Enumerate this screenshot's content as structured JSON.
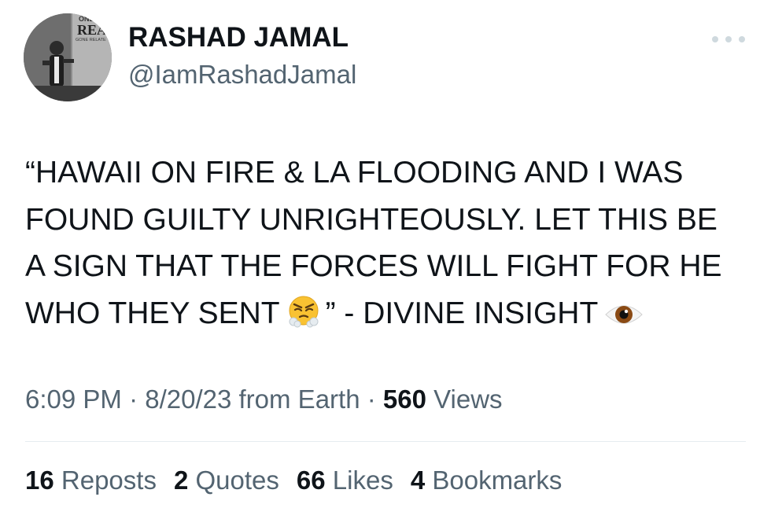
{
  "author": {
    "display_name": "RASHAD JAMAL",
    "handle": "@IamRashadJamal",
    "avatar_overlay_text": [
      "ONLY",
      "REAL",
      "GONE RELATE"
    ]
  },
  "more_menu": {
    "icon": "more-horizontal-icon"
  },
  "tweet": {
    "lines": [
      "“HAWAII ON FIRE & LA FLOODING AND I WAS",
      "FOUND GUILTY UNRIGHTEOUSLY. LET THIS BE",
      "A SIGN THAT THE FORCES WILL FIGHT FOR HE"
    ],
    "last_line_start": "WHO THEY SENT",
    "emoji_1": "face-with-steam-from-nose-emoji",
    "last_line_middle": "” - DIVINE INSIGHT",
    "emoji_2": "eye-emoji"
  },
  "meta": {
    "time": "6:09 PM",
    "sep1": " · ",
    "date": "8/20/23",
    "source": " from Earth",
    "sep2": " · ",
    "views_count": "560",
    "views_label": " Views"
  },
  "stats": [
    {
      "num": "16",
      "label": " Reposts"
    },
    {
      "num": "2",
      "label": " Quotes"
    },
    {
      "num": "66",
      "label": " Likes"
    },
    {
      "num": "4",
      "label": " Bookmarks"
    }
  ],
  "colors": {
    "text_primary": "#0f1419",
    "text_secondary": "#536471",
    "divider": "#e6ecf0"
  }
}
